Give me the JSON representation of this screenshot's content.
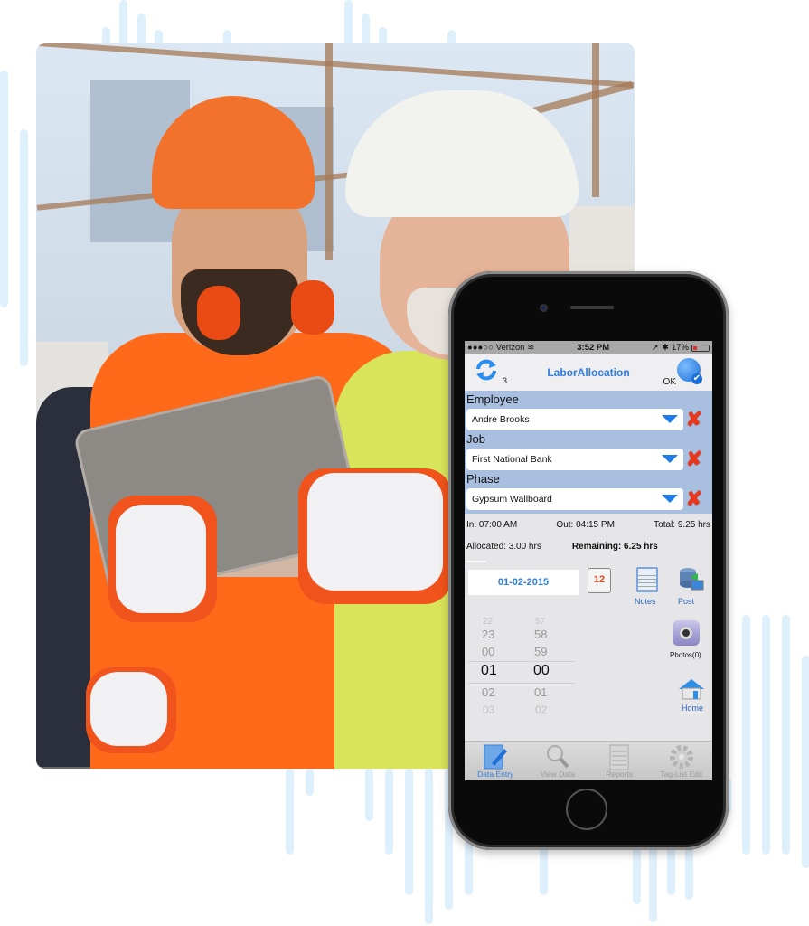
{
  "phone": {
    "status_bar": {
      "signal": "●●●○○",
      "carrier": "Verizon",
      "time": "3:52 PM",
      "battery_percent": "17%"
    },
    "title_bar": {
      "title": "LaborAllocation",
      "sync_count": "3",
      "ok_label": "OK"
    },
    "form": {
      "fields": [
        {
          "label": "Employee",
          "value": "Andre Brooks"
        },
        {
          "label": "Job",
          "value": "First National Bank"
        },
        {
          "label": "Phase",
          "value": "Gypsum Wallboard"
        }
      ]
    },
    "times": {
      "in": "In: 07:00 AM",
      "out": "Out: 04:15 PM",
      "total": "Total:  9.25 hrs",
      "allocated": "Allocated:  3.00 hrs",
      "remaining": "Remaining:  6.25 hrs"
    },
    "date": "01-02-2015",
    "calendar_icon_text": "12",
    "actions": {
      "notes": "Notes",
      "post": "Post",
      "photos": "Photos(0)",
      "home": "Home"
    },
    "picker": {
      "hours": [
        "22",
        "23",
        "00",
        "01",
        "02",
        "03"
      ],
      "minutes": [
        "57",
        "58",
        "59",
        "00",
        "01",
        "02"
      ],
      "selected_hour": "01",
      "selected_minute": "00"
    },
    "tabs": [
      {
        "label": "Data Entry",
        "icon": "pencil-document-icon",
        "active": true
      },
      {
        "label": "View Data",
        "icon": "magnifier-icon",
        "active": false
      },
      {
        "label": "Reports",
        "icon": "notepad-icon",
        "active": false
      },
      {
        "label": "Tag-List Edit",
        "icon": "gear-icon",
        "active": false
      }
    ]
  },
  "colors": {
    "accent_blue": "#2e7de0",
    "form_bg": "#a8bfe0",
    "clear_red": "#e8371a",
    "decor_line": "#dff0fd"
  }
}
